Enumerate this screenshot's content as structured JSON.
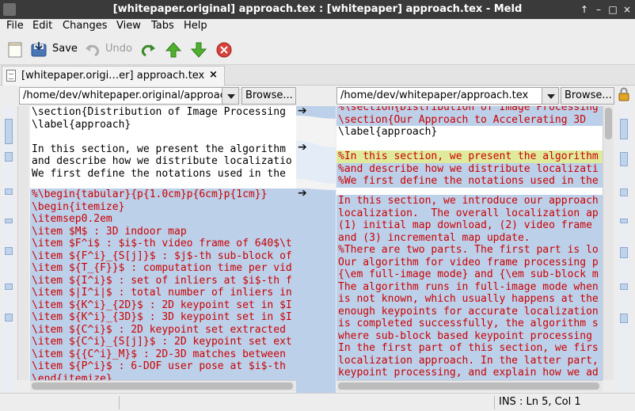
{
  "window": {
    "title": "[whitepaper.original] approach.tex : [whitepaper] approach.tex - Meld",
    "controls": [
      "↑",
      "–",
      "□",
      "×"
    ]
  },
  "menubar": [
    "File",
    "Edit",
    "Changes",
    "View",
    "Tabs",
    "Help"
  ],
  "toolbar": {
    "save": "Save",
    "undo": "Undo"
  },
  "tab": {
    "label": "[whitepaper.origi…er] approach.tex",
    "close": "×"
  },
  "left_file": {
    "path": "/home/dev/whitepaper.original/approac",
    "browse": "Browse..."
  },
  "right_file": {
    "path": "/home/dev/whitepaper/approach.tex",
    "browse": "Browse..."
  },
  "left_lines": {
    "top": [
      "\\section{Distribution of Image Processing",
      "\\label{approach}",
      "",
      "In this section, we present the algorithm",
      "and describe how we distribute localizatio",
      "We first define the notations used in the"
    ],
    "block": [
      "%\\begin{tabular}{p{1.0cm}p{6cm}p{1cm}}",
      "\\begin{itemize}",
      "\\itemsep0.2em",
      "\\item $M$ : 3D indoor map",
      "\\item $F^i$ : $i$-th video frame of 640$\\t",
      "\\item ${F^i}_{S[j]}$ : $j$-th sub-block of",
      "\\item ${T_{F}}$ : computation time per vid",
      "\\item ${I^i}$ : set of inliers at $i$-th f",
      "\\item $|I^i|$ : total number of inliers in",
      "\\item ${K^i}_{2D}$ : 2D keypoint set in $I",
      "\\item ${K^i}_{3D}$ : 3D keypoint set in $I",
      "\\item ${C^i}$ : 2D keypoint set extracted",
      "\\item ${C^i}_{S[j]}$ : 2D keypoint set ext",
      "\\item ${{C^i}_M}$ : 2D-3D matches between",
      "\\item ${P^i}$ : 6-DOF user pose at $i$-th",
      "\\end{itemize}"
    ]
  },
  "right_lines": {
    "top": [
      "%\\section{Distribution of Image Processing",
      "\\section{Our Approach to Accelerating 3D",
      "\\label{approach}",
      "",
      "%In this section, we present the algorithm",
      "%and describe how we distribute localizati",
      "%We first define the notations used in the"
    ],
    "block": [
      "In this section, we introduce our approach",
      "localization.  The overall localization ap",
      "(1) initial map download, (2) video frame",
      "and (3) incremental map update.",
      "%There are two parts. The first part is lo",
      "Our algorithm for video frame processing p",
      "{\\em full-image mode} and {\\em sub-block m",
      "The algorithm runs in full-image mode when",
      "is not known, which usually happens at the",
      "enough keypoints for accurate localization",
      "is completed successfully, the algorithm s",
      "where sub-block based keypoint processing",
      "In the first part of this section, we firs",
      "localization approach. In the latter part,",
      "keypoint processing, and explain how we ad"
    ]
  },
  "statusbar": {
    "position": "INS : Ln 5, Col 1"
  },
  "colors": {
    "inserted_bg": "#bcd0ea",
    "changed_bg": "#e0ea9c",
    "removed_text": "#cc0000"
  }
}
